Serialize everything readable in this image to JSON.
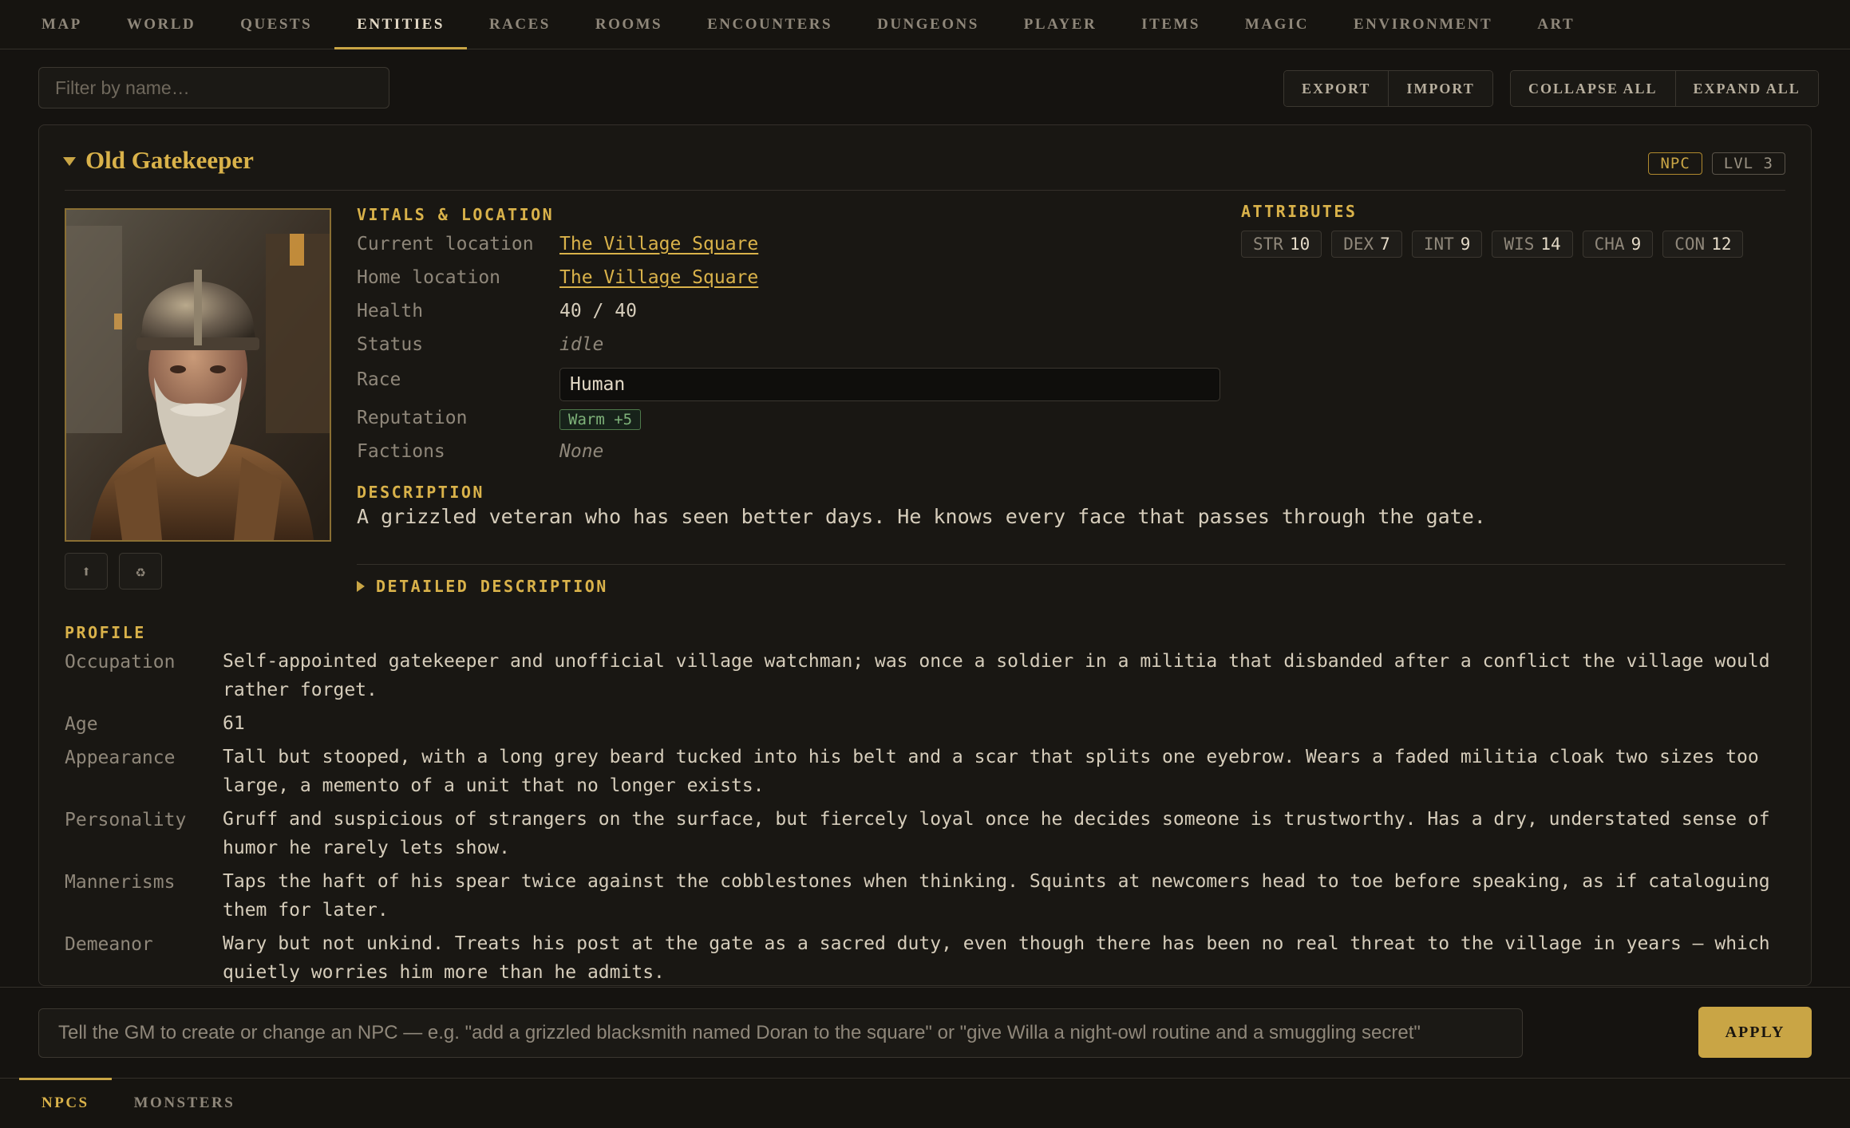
{
  "nav": {
    "tabs": [
      "MAP",
      "WORLD",
      "QUESTS",
      "ENTITIES",
      "RACES",
      "ROOMS",
      "ENCOUNTERS",
      "DUNGEONS",
      "PLAYER",
      "ITEMS",
      "MAGIC",
      "ENVIRONMENT",
      "ART"
    ],
    "active": "ENTITIES"
  },
  "toolbar": {
    "filter_placeholder": "Filter by name…",
    "export_label": "EXPORT",
    "import_label": "IMPORT",
    "collapse_label": "COLLAPSE ALL",
    "expand_label": "EXPAND ALL"
  },
  "entity": {
    "name": "Old Gatekeeper",
    "type_badge": "NPC",
    "level_badge": "LVL 3",
    "upload_icon": "⬆",
    "regenerate_icon": "♻",
    "vitals_heading": "VITALS & LOCATION",
    "vitals": {
      "current_location_label": "Current location",
      "current_location": "The Village Square",
      "home_location_label": "Home location",
      "home_location": "The Village Square",
      "health_label": "Health",
      "health": "40 / 40",
      "status_label": "Status",
      "status": "idle",
      "race_label": "Race",
      "race": "Human",
      "reputation_label": "Reputation",
      "reputation": "Warm +5",
      "factions_label": "Factions",
      "factions": "None"
    },
    "attributes_heading": "ATTRIBUTES",
    "attributes": [
      {
        "key": "STR",
        "value": "10"
      },
      {
        "key": "DEX",
        "value": "7"
      },
      {
        "key": "INT",
        "value": "9"
      },
      {
        "key": "WIS",
        "value": "14"
      },
      {
        "key": "CHA",
        "value": "9"
      },
      {
        "key": "CON",
        "value": "12"
      }
    ],
    "description_heading": "DESCRIPTION",
    "description": "A grizzled veteran who has seen better days. He knows every face that passes through the gate.",
    "detailed_heading": "DETAILED DESCRIPTION",
    "profile_heading": "PROFILE",
    "profile": [
      {
        "label": "Occupation",
        "value": "Self-appointed gatekeeper and unofficial village watchman; was once a soldier in a militia that disbanded after a conflict the village would rather forget."
      },
      {
        "label": "Age",
        "value": "61"
      },
      {
        "label": "Appearance",
        "value": "Tall but stooped, with a long grey beard tucked into his belt and a scar that splits one eyebrow. Wears a faded militia cloak two sizes too large, a memento of a unit that no longer exists."
      },
      {
        "label": "Personality",
        "value": "Gruff and suspicious of strangers on the surface, but fiercely loyal once he decides someone is trustworthy. Has a dry, understated sense of humor he rarely lets show."
      },
      {
        "label": "Mannerisms",
        "value": "Taps the haft of his spear twice against the cobblestones when thinking. Squints at newcomers head to toe before speaking, as if cataloguing them for later."
      },
      {
        "label": "Demeanor",
        "value": "Wary but not unkind. Treats his post at the gate as a sacred duty, even though there has been no real threat to the village in years — which quietly worries him more than he admits."
      }
    ]
  },
  "command": {
    "placeholder": "Tell the GM to create or change an NPC — e.g. \"add a grizzled blacksmith named Doran to the square\" or \"give Willa a night-owl routine and a smuggling secret\"",
    "apply_label": "APPLY"
  },
  "subnav": {
    "tabs": [
      "NPCS",
      "MONSTERS"
    ],
    "active": "NPCS"
  },
  "colors": {
    "accent": "#c9a545",
    "background": "#151310",
    "panel": "#191713"
  }
}
